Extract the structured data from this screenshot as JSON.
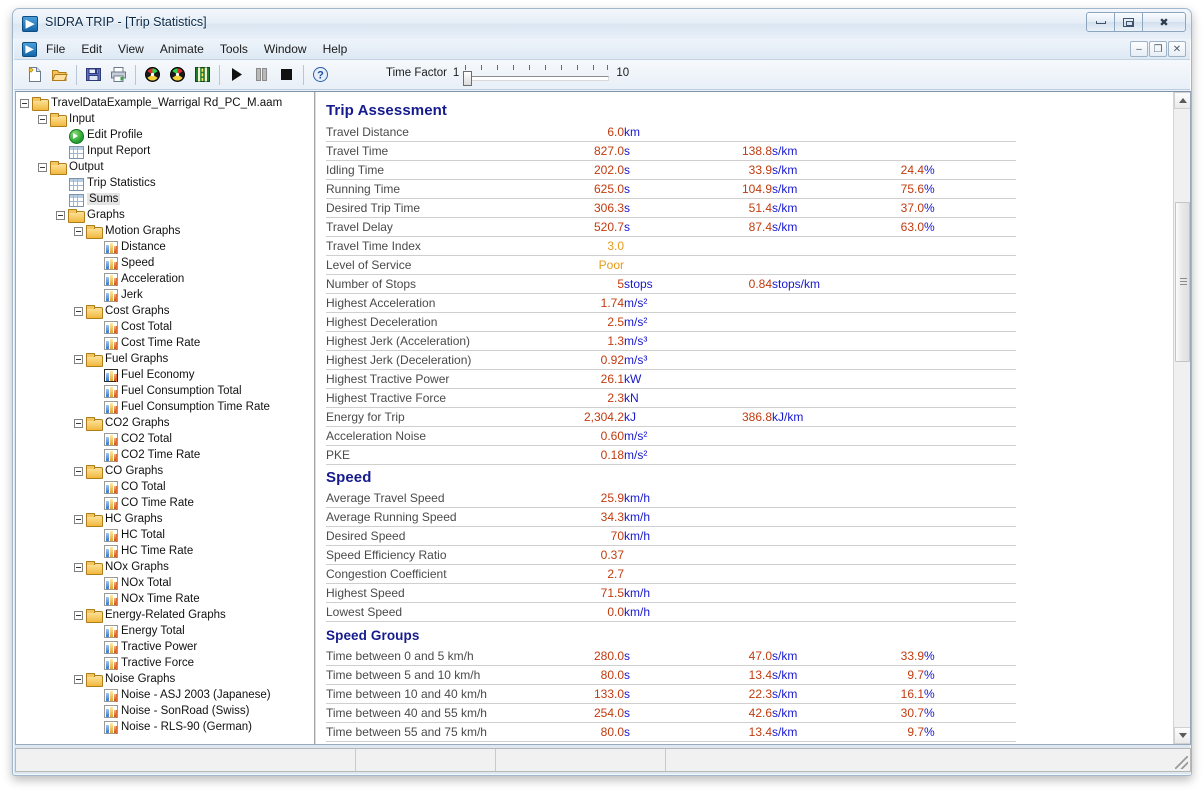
{
  "window": {
    "title": "SIDRA TRIP - [Trip Statistics]",
    "app_icon": "▶",
    "minimize_label": "",
    "maximize_label": "",
    "close_label": "✖"
  },
  "mdi_buttons": {
    "minimize": "–",
    "restore": "❐",
    "close": "✕"
  },
  "menu": {
    "app_icon": "▶",
    "items": [
      {
        "label": "File"
      },
      {
        "label": "Edit"
      },
      {
        "label": "View"
      },
      {
        "label": "Animate"
      },
      {
        "label": "Tools"
      },
      {
        "label": "Window"
      },
      {
        "label": "Help"
      }
    ]
  },
  "toolbar": {
    "buttons": [
      {
        "name": "new-file-icon",
        "title": "New"
      },
      {
        "name": "open-folder-icon",
        "title": "Open"
      },
      {
        "name": "save-icon",
        "title": "Save"
      },
      {
        "name": "print-icon",
        "title": "Print"
      },
      {
        "name": "gauge-icon",
        "title": "Gauge"
      },
      {
        "name": "gauge-alt-icon",
        "title": "Gauge 2"
      },
      {
        "name": "road-graph-icon",
        "title": "Road Graph"
      },
      {
        "name": "play-icon",
        "title": "Play"
      },
      {
        "name": "pause-icon",
        "title": "Pause"
      },
      {
        "name": "stop-icon",
        "title": "Stop"
      },
      {
        "name": "help-icon",
        "title": "Help"
      }
    ],
    "time_factor": {
      "label": "Time Factor",
      "min": "1",
      "max": "10",
      "value": 1
    }
  },
  "tree": {
    "nodes": [
      {
        "depth": 0,
        "label": "TravelDataExample_Warrigal Rd_PC_M.aam",
        "icon": "folder",
        "expander": true,
        "selected": false
      },
      {
        "depth": 1,
        "label": "Input",
        "icon": "folder",
        "expander": true,
        "selected": false
      },
      {
        "depth": 2,
        "label": "Edit Profile",
        "icon": "arrow",
        "expander": false,
        "selected": false
      },
      {
        "depth": 2,
        "label": "Input Report",
        "icon": "grid",
        "expander": false,
        "selected": false
      },
      {
        "depth": 1,
        "label": "Output",
        "icon": "folder",
        "expander": true,
        "selected": false
      },
      {
        "depth": 2,
        "label": "Trip Statistics",
        "icon": "grid",
        "expander": false,
        "selected": false
      },
      {
        "depth": 2,
        "label": "Sums",
        "icon": "grid",
        "expander": false,
        "selected": true
      },
      {
        "depth": 2,
        "label": "Graphs",
        "icon": "folder",
        "expander": true,
        "selected": false
      },
      {
        "depth": 3,
        "label": "Motion Graphs",
        "icon": "folder",
        "expander": true,
        "selected": false
      },
      {
        "depth": 4,
        "label": "Distance",
        "icon": "chart",
        "expander": false,
        "selected": false
      },
      {
        "depth": 4,
        "label": "Speed",
        "icon": "chart",
        "expander": false,
        "selected": false
      },
      {
        "depth": 4,
        "label": "Acceleration",
        "icon": "chart",
        "expander": false,
        "selected": false
      },
      {
        "depth": 4,
        "label": "Jerk",
        "icon": "chart",
        "expander": false,
        "selected": false
      },
      {
        "depth": 3,
        "label": "Cost Graphs",
        "icon": "folder",
        "expander": true,
        "selected": false
      },
      {
        "depth": 4,
        "label": "Cost Total",
        "icon": "chart",
        "expander": false,
        "selected": false
      },
      {
        "depth": 4,
        "label": "Cost Time Rate",
        "icon": "chart",
        "expander": false,
        "selected": false
      },
      {
        "depth": 3,
        "label": "Fuel Graphs",
        "icon": "folder",
        "expander": true,
        "selected": false
      },
      {
        "depth": 4,
        "label": "Fuel Economy",
        "icon": "chart-hl",
        "expander": false,
        "selected": false
      },
      {
        "depth": 4,
        "label": "Fuel Consumption Total",
        "icon": "chart",
        "expander": false,
        "selected": false
      },
      {
        "depth": 4,
        "label": "Fuel Consumption Time Rate",
        "icon": "chart",
        "expander": false,
        "selected": false
      },
      {
        "depth": 3,
        "label": "CO2 Graphs",
        "icon": "folder",
        "expander": true,
        "selected": false
      },
      {
        "depth": 4,
        "label": "CO2 Total",
        "icon": "chart",
        "expander": false,
        "selected": false
      },
      {
        "depth": 4,
        "label": "CO2 Time Rate",
        "icon": "chart",
        "expander": false,
        "selected": false
      },
      {
        "depth": 3,
        "label": "CO Graphs",
        "icon": "folder",
        "expander": true,
        "selected": false
      },
      {
        "depth": 4,
        "label": "CO Total",
        "icon": "chart",
        "expander": false,
        "selected": false
      },
      {
        "depth": 4,
        "label": "CO Time Rate",
        "icon": "chart",
        "expander": false,
        "selected": false
      },
      {
        "depth": 3,
        "label": "HC Graphs",
        "icon": "folder",
        "expander": true,
        "selected": false
      },
      {
        "depth": 4,
        "label": "HC Total",
        "icon": "chart",
        "expander": false,
        "selected": false
      },
      {
        "depth": 4,
        "label": "HC Time Rate",
        "icon": "chart",
        "expander": false,
        "selected": false
      },
      {
        "depth": 3,
        "label": "NOx Graphs",
        "icon": "folder",
        "expander": true,
        "selected": false
      },
      {
        "depth": 4,
        "label": "NOx Total",
        "icon": "chart",
        "expander": false,
        "selected": false
      },
      {
        "depth": 4,
        "label": "NOx Time Rate",
        "icon": "chart",
        "expander": false,
        "selected": false
      },
      {
        "depth": 3,
        "label": "Energy-Related Graphs",
        "icon": "folder",
        "expander": true,
        "selected": false
      },
      {
        "depth": 4,
        "label": "Energy Total",
        "icon": "chart",
        "expander": false,
        "selected": false
      },
      {
        "depth": 4,
        "label": "Tractive Power",
        "icon": "chart",
        "expander": false,
        "selected": false
      },
      {
        "depth": 4,
        "label": "Tractive Force",
        "icon": "chart",
        "expander": false,
        "selected": false
      },
      {
        "depth": 3,
        "label": "Noise Graphs",
        "icon": "folder",
        "expander": true,
        "selected": false
      },
      {
        "depth": 4,
        "label": "Noise - ASJ 2003 (Japanese)",
        "icon": "chart",
        "expander": false,
        "selected": false
      },
      {
        "depth": 4,
        "label": "Noise - SonRoad (Swiss)",
        "icon": "chart",
        "expander": false,
        "selected": false
      },
      {
        "depth": 4,
        "label": "Noise - RLS-90 (German)",
        "icon": "chart",
        "expander": false,
        "selected": false
      }
    ]
  },
  "report": {
    "sections": [
      {
        "title": "Trip Assessment",
        "level": "main",
        "rows": [
          {
            "name": "Travel Distance",
            "v1": "6.0",
            "u1": "km",
            "v2": "",
            "u2": "",
            "v3": "",
            "u3": ""
          },
          {
            "name": "Travel Time",
            "v1": "827.0",
            "u1": "s",
            "v2": "138.8",
            "u2": "s/km",
            "v3": "",
            "u3": ""
          },
          {
            "name": "Idling Time",
            "v1": "202.0",
            "u1": "s",
            "v2": "33.9",
            "u2": "s/km",
            "v3": "24.4",
            "u3": "%"
          },
          {
            "name": "Running Time",
            "v1": "625.0",
            "u1": "s",
            "v2": "104.9",
            "u2": "s/km",
            "v3": "75.6",
            "u3": "%"
          },
          {
            "name": "Desired Trip Time",
            "v1": "306.3",
            "u1": "s",
            "v2": "51.4",
            "u2": "s/km",
            "v3": "37.0",
            "u3": "%"
          },
          {
            "name": "Travel Delay",
            "v1": "520.7",
            "u1": "s",
            "v2": "87.4",
            "u2": "s/km",
            "v3": "63.0",
            "u3": "%"
          },
          {
            "name": "Travel Time Index",
            "v1": "3.0",
            "u1": "",
            "v2": "",
            "u2": "",
            "v3": "",
            "u3": "",
            "amber": true
          },
          {
            "name": "Level of Service",
            "v1": "Poor",
            "u1": "",
            "v2": "",
            "u2": "",
            "v3": "",
            "u3": "",
            "amber": true
          },
          {
            "name": "Number of Stops",
            "v1": "5",
            "u1": "stops",
            "v2": "0.84",
            "u2": "stops/km",
            "v3": "",
            "u3": ""
          },
          {
            "name": "Highest Acceleration",
            "v1": "1.74",
            "u1": "m/s²",
            "v2": "",
            "u2": "",
            "v3": "",
            "u3": ""
          },
          {
            "name": "Highest Deceleration",
            "v1": "2.5",
            "u1": "m/s²",
            "v2": "",
            "u2": "",
            "v3": "",
            "u3": ""
          },
          {
            "name": "Highest Jerk (Acceleration)",
            "v1": "1.3",
            "u1": "m/s³",
            "v2": "",
            "u2": "",
            "v3": "",
            "u3": ""
          },
          {
            "name": "Highest Jerk (Deceleration)",
            "v1": "0.92",
            "u1": "m/s³",
            "v2": "",
            "u2": "",
            "v3": "",
            "u3": ""
          },
          {
            "name": "Highest Tractive Power",
            "v1": "26.1",
            "u1": "kW",
            "v2": "",
            "u2": "",
            "v3": "",
            "u3": ""
          },
          {
            "name": "Highest Tractive Force",
            "v1": "2.3",
            "u1": "kN",
            "v2": "",
            "u2": "",
            "v3": "",
            "u3": ""
          },
          {
            "name": "Energy for Trip",
            "v1": "2,304.2",
            "u1": "kJ",
            "v2": "386.8",
            "u2": "kJ/km",
            "v3": "",
            "u3": ""
          },
          {
            "name": "Acceleration Noise",
            "v1": "0.60",
            "u1": "m/s²",
            "v2": "",
            "u2": "",
            "v3": "",
            "u3": ""
          },
          {
            "name": "PKE",
            "v1": "0.18",
            "u1": "m/s²",
            "v2": "",
            "u2": "",
            "v3": "",
            "u3": ""
          }
        ]
      },
      {
        "title": "Speed",
        "level": "main",
        "rows": [
          {
            "name": "Average Travel Speed",
            "v1": "25.9",
            "u1": "km/h",
            "v2": "",
            "u2": "",
            "v3": "",
            "u3": ""
          },
          {
            "name": "Average Running Speed",
            "v1": "34.3",
            "u1": "km/h",
            "v2": "",
            "u2": "",
            "v3": "",
            "u3": ""
          },
          {
            "name": "Desired Speed",
            "v1": "70",
            "u1": "km/h",
            "v2": "",
            "u2": "",
            "v3": "",
            "u3": ""
          },
          {
            "name": "Speed Efficiency Ratio",
            "v1": "0.37",
            "u1": "",
            "v2": "",
            "u2": "",
            "v3": "",
            "u3": ""
          },
          {
            "name": "Congestion Coefficient",
            "v1": "2.7",
            "u1": "",
            "v2": "",
            "u2": "",
            "v3": "",
            "u3": ""
          },
          {
            "name": "Highest Speed",
            "v1": "71.5",
            "u1": "km/h",
            "v2": "",
            "u2": "",
            "v3": "",
            "u3": ""
          },
          {
            "name": "Lowest Speed",
            "v1": "0.0",
            "u1": "km/h",
            "v2": "",
            "u2": "",
            "v3": "",
            "u3": ""
          }
        ]
      },
      {
        "title": "Speed Groups",
        "level": "sub",
        "rows": [
          {
            "name": "Time between 0 and 5 km/h",
            "v1": "280.0",
            "u1": "s",
            "v2": "47.0",
            "u2": "s/km",
            "v3": "33.9",
            "u3": "%"
          },
          {
            "name": "Time between 5 and 10 km/h",
            "v1": "80.0",
            "u1": "s",
            "v2": "13.4",
            "u2": "s/km",
            "v3": "9.7",
            "u3": "%"
          },
          {
            "name": "Time between 10 and 40 km/h",
            "v1": "133.0",
            "u1": "s",
            "v2": "22.3",
            "u2": "s/km",
            "v3": "16.1",
            "u3": "%"
          },
          {
            "name": "Time between 40 and 55 km/h",
            "v1": "254.0",
            "u1": "s",
            "v2": "42.6",
            "u2": "s/km",
            "v3": "30.7",
            "u3": "%"
          },
          {
            "name": "Time between 55 and 75 km/h",
            "v1": "80.0",
            "u1": "s",
            "v2": "13.4",
            "u2": "s/km",
            "v3": "9.7",
            "u3": "%"
          }
        ]
      }
    ]
  },
  "statusbar": {
    "panel1": "",
    "panel2": "",
    "panel3": "",
    "panel4": ""
  },
  "colors": {
    "value": "#c23b0e",
    "unit": "#1717d0",
    "heading": "#151b8d",
    "amber": "#e79a18",
    "label": "#4a4a4a"
  }
}
